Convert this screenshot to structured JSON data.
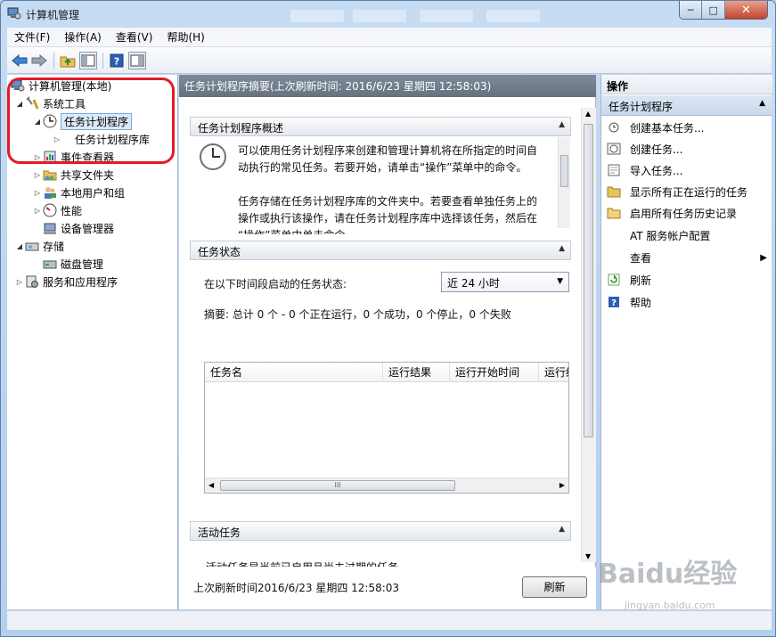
{
  "window": {
    "title": "计算机管理"
  },
  "controls": {
    "minimize": "─",
    "maximize": "□",
    "close": "✕"
  },
  "menu": [
    "文件(F)",
    "操作(A)",
    "查看(V)",
    "帮助(H)"
  ],
  "toolbar_icons": [
    "back-arrow-icon",
    "forward-arrow-icon",
    "up-folder-icon",
    "show-hide-tree-icon",
    "help-icon",
    "show-action-pane-icon"
  ],
  "tree": {
    "root": "计算机管理(本地)",
    "system_tools": "系统工具",
    "task_scheduler": "任务计划程序",
    "task_library": "任务计划程序库",
    "event_viewer": "事件查看器",
    "shared_folders": "共享文件夹",
    "local_users": "本地用户和组",
    "performance": "性能",
    "device_manager": "设备管理器",
    "storage": "存储",
    "disk_management": "磁盘管理",
    "services_apps": "服务和应用程序"
  },
  "main": {
    "header": "任务计划程序摘要(上次刷新时间: 2016/6/23 星期四 12:58:03)",
    "overview_title": "任务计划程序概述",
    "overview_p1_l1": "可以使用任务计划程序来创建和管理计算机将在所指定的时间自",
    "overview_p1_l2": "动执行的常见任务。若要开始，请单击“操作”菜单中的命令。",
    "overview_p2_l1": "任务存储在任务计划程序库的文件夹中。若要查看单独任务上的",
    "overview_p2_l2": "操作或执行该操作，请在任务计划程序库中选择该任务，然后在",
    "overview_p2_l3": "“操作”菜单中单击命令。",
    "status_title": "任务状态",
    "status_label": "在以下时间段启动的任务状态:",
    "range_value": "近 24 小时",
    "summary": "摘要: 总计 0 个 - 0 个正在运行，0 个成功，0 个停止，0 个失败",
    "columns": [
      "任务名",
      "运行结果",
      "运行开始时间",
      "运行结"
    ],
    "scroll_grip": "III",
    "active_title": "活动任务",
    "active_text": "活动任务是当前已启用且尚未过期的任务。",
    "footer_refresh": "上次刷新时间2016/6/23 星期四 12:58:03",
    "refresh_button": "刷新"
  },
  "actions": {
    "title": "操作",
    "subtitle": "任务计划程序",
    "items": [
      "创建基本任务...",
      "创建任务...",
      "导入任务...",
      "显示所有正在运行的任务",
      "启用所有任务历史记录",
      "AT 服务帐户配置",
      "查看",
      "刷新",
      "帮助"
    ]
  },
  "watermark": {
    "brand": "Baidu经验",
    "url": "jingyan.baidu.com"
  },
  "colors": {
    "accent": "#3d6fb6",
    "annotation": "#e31b23",
    "header": "#727e8c"
  }
}
